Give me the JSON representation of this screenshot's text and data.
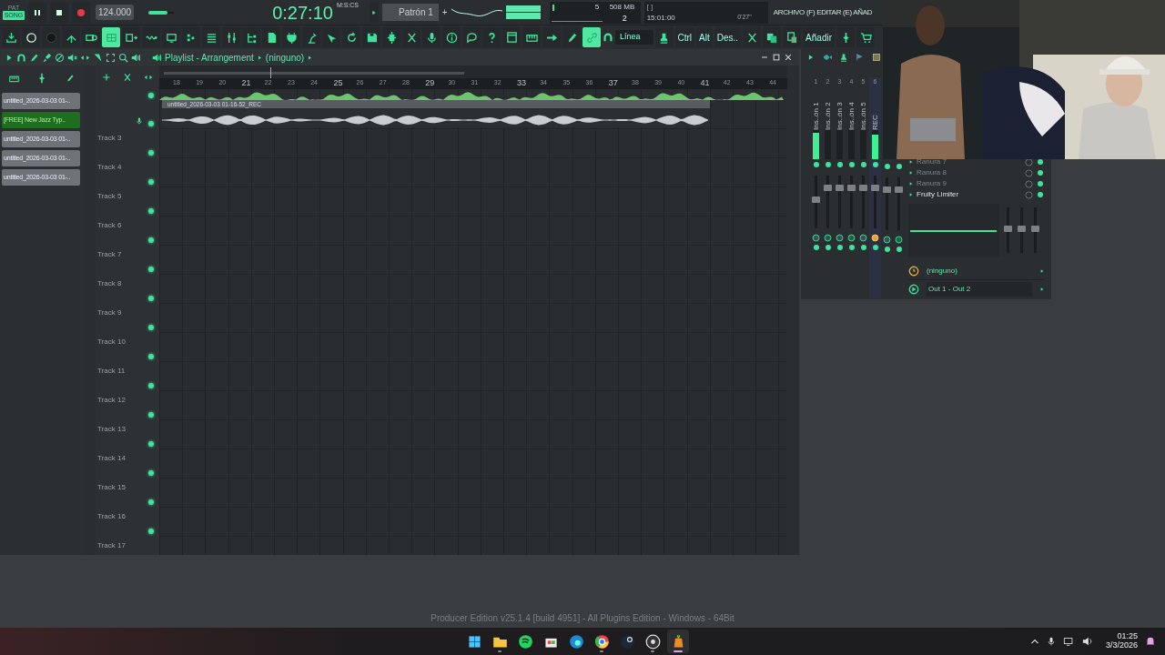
{
  "transport": {
    "mode_alt": "PAT",
    "mode": "SONG",
    "song_mode": true,
    "recording": true,
    "tempo": "124.000",
    "master_pitch": {
      "level": 0.75
    },
    "time": "0:27:10",
    "time_unit": "M:S:CS",
    "pattern": "Patrón 1",
    "pattern_add": "+",
    "cpu": "5",
    "memory": "508 MB",
    "voices": "2",
    "hint_marker": "[ ]",
    "hint_time": "15:01:00",
    "duration": "0'27\"",
    "menu": "ARCHIVO (F) EDITAR (E) AÑAD"
  },
  "toolbar": [
    {
      "kind": "download",
      "selected": false
    },
    {
      "kind": "knob",
      "selected": false
    },
    {
      "kind": "dark-knob",
      "selected": false
    },
    {
      "kind": "peak",
      "selected": false
    },
    {
      "kind": "tape",
      "selected": false
    },
    {
      "kind": "grid",
      "selected": true
    },
    {
      "kind": "keys",
      "selected": false
    },
    {
      "kind": "wave",
      "selected": false
    },
    {
      "kind": "monitor",
      "selected": false
    },
    {
      "kind": "steps",
      "selected": false
    },
    {
      "kind": "list",
      "selected": false
    },
    {
      "kind": "faders",
      "selected": false
    },
    {
      "kind": "tree",
      "selected": false
    },
    {
      "kind": "document",
      "selected": false
    },
    {
      "kind": "plug",
      "selected": false
    },
    {
      "kind": "lamp",
      "selected": false
    },
    {
      "kind": "pointer",
      "selected": false
    },
    {
      "kind": "refresh",
      "selected": false
    },
    {
      "kind": "save",
      "selected": false
    },
    {
      "kind": "chip",
      "selected": false
    },
    {
      "kind": "scissors",
      "selected": false
    },
    {
      "kind": "mic",
      "selected": false
    },
    {
      "kind": "info",
      "selected": false
    },
    {
      "kind": "chat",
      "selected": false
    },
    {
      "kind": "help",
      "selected": false
    },
    {
      "kind": "window",
      "selected": false
    },
    {
      "kind": "keyboard",
      "selected": false
    },
    {
      "kind": "arrow",
      "selected": false
    },
    {
      "kind": "pen",
      "selected": false
    },
    {
      "kind": "link",
      "selected": true
    },
    {
      "kind": "dropdown",
      "label": "Línea",
      "selected": false
    },
    {
      "kind": "stamp",
      "selected": false
    },
    {
      "kind": "text",
      "label": "Ctrl",
      "selected": false
    },
    {
      "kind": "text",
      "label": "Alt",
      "selected": false
    },
    {
      "kind": "text",
      "label": "Des..",
      "selected": false
    },
    {
      "kind": "scissors",
      "selected": false
    },
    {
      "kind": "copy",
      "selected": false
    },
    {
      "kind": "paste",
      "selected": false
    },
    {
      "kind": "text",
      "label": "Añadir",
      "selected": false
    },
    {
      "kind": "split",
      "selected": false
    },
    {
      "kind": "cart",
      "selected": false
    }
  ],
  "playlist": {
    "title": "Playlist - Arrangement",
    "pattern": "(ninguno)",
    "clips": [
      {
        "label": "untitled_2026-03-03 01-..",
        "selected": false
      },
      {
        "label": "[FREE] New Jazz Typ..",
        "selected": true
      },
      {
        "label": "untitled_2026-03-03 01-..",
        "selected": false
      },
      {
        "label": "untitled_2026-03-03 01-..",
        "selected": false
      },
      {
        "label": "untitled_2026-03-03 01-..",
        "selected": false
      }
    ],
    "ruler": [
      "18",
      "19",
      "20",
      "21",
      "22",
      "23",
      "24",
      "25",
      "26",
      "27",
      "28",
      "29",
      "30",
      "31",
      "32",
      "33",
      "34",
      "35",
      "36",
      "37",
      "38",
      "39",
      "40",
      "41",
      "42",
      "43",
      "44"
    ],
    "recording_clip": "untitled_2026-03-03 01-16-52_REC",
    "tracks": [
      {
        "label": "Track 3"
      },
      {
        "label": "Track 4"
      },
      {
        "label": "Track 5"
      },
      {
        "label": "Track 6"
      },
      {
        "label": "Track 7"
      },
      {
        "label": "Track 8"
      },
      {
        "label": "Track 9"
      },
      {
        "label": "Track 10"
      },
      {
        "label": "Track 11"
      },
      {
        "label": "Track 12"
      },
      {
        "label": "Track 13"
      },
      {
        "label": "Track 14"
      },
      {
        "label": "Track 15"
      },
      {
        "label": "Track 16"
      },
      {
        "label": "Track 17"
      }
    ]
  },
  "mixer": {
    "strips": [
      {
        "number": "1",
        "label": "Ins..ón 1",
        "selected": false,
        "armed": false,
        "meter": {
          "level": 0.9
        },
        "fader": {
          "level": 0.55
        }
      },
      {
        "number": "2",
        "label": "Ins..ón 2",
        "selected": false,
        "armed": false,
        "fader": {
          "level": 0.8
        }
      },
      {
        "number": "3",
        "label": "Ins..ón 3",
        "selected": false,
        "armed": false,
        "fader": {
          "level": 0.8
        }
      },
      {
        "number": "4",
        "label": "Ins..ón 4",
        "selected": false,
        "armed": false,
        "fader": {
          "level": 0.8
        }
      },
      {
        "number": "5",
        "label": "Ins..ón 5",
        "selected": false,
        "armed": false,
        "fader": {
          "level": 0.8
        }
      },
      {
        "number": "6",
        "label": "REC",
        "selected": true,
        "armed": true,
        "meter": {
          "level": 0.85
        },
        "fader": {
          "level": 0.8
        }
      },
      {
        "selected": false,
        "armed": false,
        "fader": {
          "level": 0.8
        }
      },
      {
        "selected": false,
        "armed": false,
        "fader": {
          "level": 0.8
        }
      }
    ],
    "slots": [
      {
        "label": "Ranura 7",
        "enabled": false
      },
      {
        "label": "Ranura 8",
        "enabled": false
      },
      {
        "label": "Ranura 9",
        "enabled": false
      },
      {
        "label": "Fruity Limiter",
        "enabled": true
      }
    ],
    "send": "(ninguno)",
    "output": "Out 1 - Out 2"
  },
  "status": "Producer Edition v25.1.4 [build 4951] - All Plugins Edition - Windows - 64Bit",
  "taskbar": {
    "apps": [
      {
        "kind": "start",
        "running": false,
        "selected": false
      },
      {
        "kind": "folder",
        "running": true,
        "selected": false
      },
      {
        "kind": "music",
        "running": false,
        "selected": false
      },
      {
        "kind": "store",
        "running": false,
        "selected": false
      },
      {
        "kind": "browser",
        "running": false,
        "selected": false
      },
      {
        "kind": "ring",
        "running": true,
        "selected": false
      },
      {
        "kind": "steam",
        "running": false,
        "selected": false
      },
      {
        "kind": "record",
        "running": true,
        "selected": false
      },
      {
        "kind": "fruit",
        "running": true,
        "selected": true
      }
    ],
    "time": "01:25",
    "date": "3/3/2026"
  }
}
